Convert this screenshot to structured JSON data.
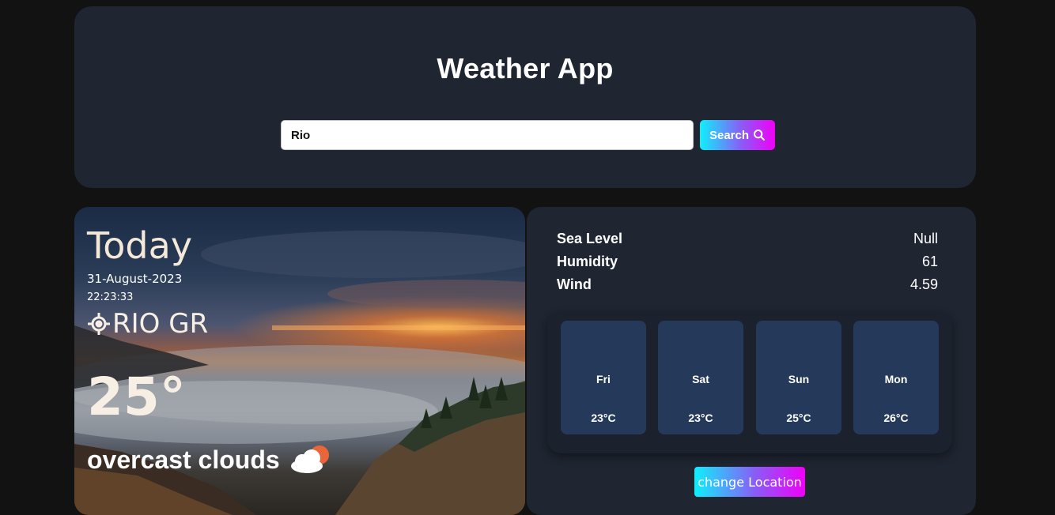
{
  "header": {
    "title": "Weather App",
    "search_value": "Rio",
    "search_button_label": "Search"
  },
  "today": {
    "label": "Today",
    "date": "31-August-2023",
    "time": "22:23:33",
    "location": "RIO GR",
    "temperature": "25°",
    "condition": "overcast clouds",
    "condition_icon": "cloud-sun-icon"
  },
  "details": {
    "rows": [
      {
        "key": "Sea Level",
        "value": "Null"
      },
      {
        "key": "Humidity",
        "value": "61"
      },
      {
        "key": "Wind",
        "value": "4.59"
      }
    ]
  },
  "forecast": [
    {
      "day": "Fri",
      "temp": "23°C"
    },
    {
      "day": "Sat",
      "temp": "23°C"
    },
    {
      "day": "Sun",
      "temp": "25°C"
    },
    {
      "day": "Mon",
      "temp": "26°C"
    }
  ],
  "change_location_label": "change Location",
  "colors": {
    "page_bg": "#121212",
    "card_bg": "#1f2531",
    "forecast_tile": "#253a5a",
    "gradient_start": "#0ff0fc",
    "gradient_end": "#f000f8"
  }
}
